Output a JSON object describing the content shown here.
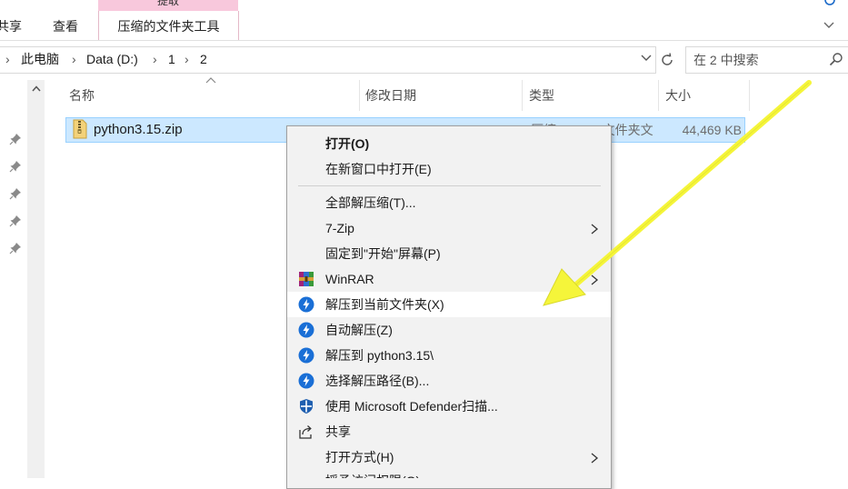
{
  "ribbon": {
    "tabs": [
      {
        "label": "共享"
      },
      {
        "label": "查看"
      }
    ],
    "context_group_label": "提取",
    "context_tab_label": "压缩的文件夹工具"
  },
  "address": {
    "crumbs": [
      {
        "label": "此电脑"
      },
      {
        "label": "Data (D:)"
      },
      {
        "label": "1"
      },
      {
        "label": "2"
      }
    ]
  },
  "search": {
    "placeholder": "在 2 中搜索"
  },
  "columns": {
    "name": "名称",
    "modified": "修改日期",
    "type": "类型",
    "size": "大小"
  },
  "file": {
    "name": "python3.15.zip",
    "type": "压缩(zipped)文件夹文件...",
    "size": "44,469 KB"
  },
  "context_menu": {
    "items": [
      {
        "label": "打开(O)",
        "bold": true,
        "icon": null,
        "submenu": false
      },
      {
        "label": "在新窗口中打开(E)",
        "icon": null,
        "submenu": false
      },
      {
        "label": "全部解压缩(T)...",
        "icon": null,
        "submenu": false
      },
      {
        "label": "7-Zip",
        "icon": null,
        "submenu": true
      },
      {
        "label": "固定到\"开始\"屏幕(P)",
        "icon": null,
        "submenu": false
      },
      {
        "label": "WinRAR",
        "icon": "winrar-icon",
        "submenu": true
      },
      {
        "label": "解压到当前文件夹(X)",
        "icon": "bandizip-icon",
        "submenu": false,
        "highlighted": true
      },
      {
        "label": "自动解压(Z)",
        "icon": "bandizip-icon",
        "submenu": false
      },
      {
        "label": "解压到 python3.15\\",
        "icon": "bandizip-icon",
        "submenu": false
      },
      {
        "label": "选择解压路径(B)...",
        "icon": "bandizip-icon",
        "submenu": false
      },
      {
        "label": "使用 Microsoft Defender扫描...",
        "icon": "defender-shield-icon",
        "submenu": false
      },
      {
        "label": "共享",
        "icon": "share-icon",
        "submenu": false
      },
      {
        "label": "打开方式(H)",
        "icon": null,
        "submenu": true
      },
      {
        "label": "授予访问权限(G)",
        "icon": null,
        "submenu": true
      }
    ]
  },
  "colors": {
    "selection_bg": "#cce8ff",
    "selection_border": "#99d1ff",
    "context_tab_accent": "#f8c8dc",
    "annotation_arrow": "#f5f53a",
    "bandizip_blue": "#1a6fd6"
  }
}
